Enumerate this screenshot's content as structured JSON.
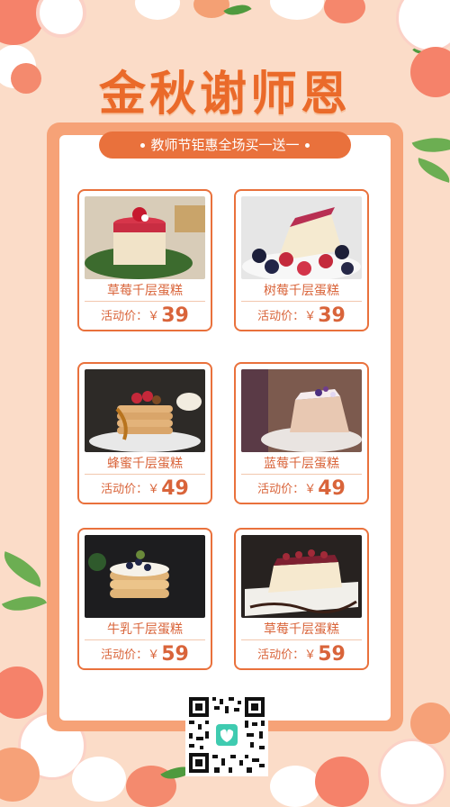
{
  "title": "金秋谢师恩",
  "banner": "教师节钜惠全场买一送一",
  "products": [
    {
      "name": "草莓千层蛋糕",
      "price_label": "活动价：￥",
      "price": "39"
    },
    {
      "name": "树莓千层蛋糕",
      "price_label": "活动价：￥",
      "price": "39"
    },
    {
      "name": "蜂蜜千层蛋糕",
      "price_label": "活动价：￥",
      "price": "49"
    },
    {
      "name": "蓝莓千层蛋糕",
      "price_label": "活动价：￥",
      "price": "49"
    },
    {
      "name": "牛乳千层蛋糕",
      "price_label": "活动价：￥",
      "price": "59"
    },
    {
      "name": "草莓千层蛋糕",
      "price_label": "活动价：￥",
      "price": "59"
    }
  ],
  "colors": {
    "accent": "#e9713c",
    "background": "#fbdcc8",
    "card_border": "#f6a277"
  }
}
